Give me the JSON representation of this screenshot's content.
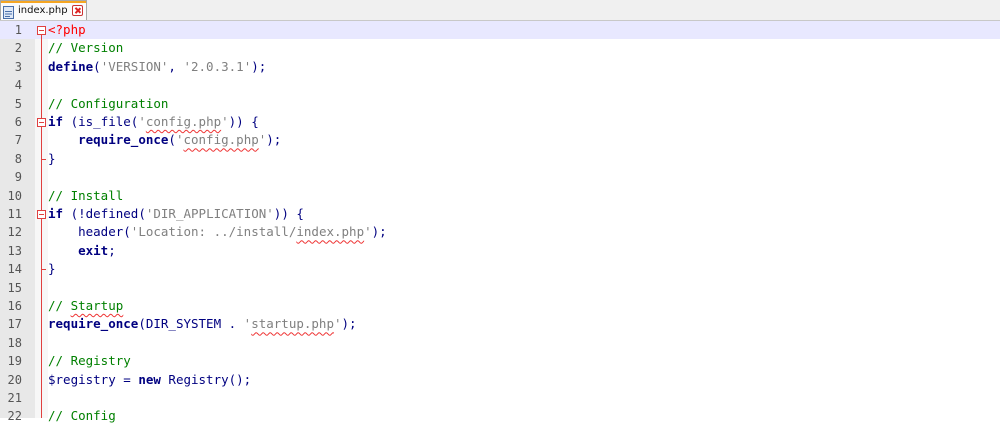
{
  "tab": {
    "filename": "index.php"
  },
  "editor": {
    "lines": [
      {
        "n": "1",
        "parts": [
          {
            "t": "<?php",
            "c": "php-tag"
          }
        ]
      },
      {
        "n": "2",
        "parts": [
          {
            "t": "// Version",
            "c": "comment"
          }
        ]
      },
      {
        "n": "3",
        "parts": [
          {
            "t": "define",
            "c": "kw"
          },
          {
            "t": "(",
            "c": "op"
          },
          {
            "t": "'VERSION'",
            "c": "str"
          },
          {
            "t": ", ",
            "c": "op"
          },
          {
            "t": "'2.0.3.1'",
            "c": "str"
          },
          {
            "t": ");",
            "c": "op"
          }
        ]
      },
      {
        "n": "4",
        "parts": []
      },
      {
        "n": "5",
        "parts": [
          {
            "t": "// Configuration",
            "c": "comment"
          }
        ]
      },
      {
        "n": "6",
        "parts": [
          {
            "t": "if",
            "c": "kw"
          },
          {
            "t": " (is_file(",
            "c": "op"
          },
          {
            "t": "'config.php'",
            "c": "str"
          },
          {
            "t": ")) {",
            "c": "op"
          }
        ]
      },
      {
        "n": "7",
        "parts": [
          {
            "t": "    ",
            "c": ""
          },
          {
            "t": "require_once",
            "c": "kw"
          },
          {
            "t": "(",
            "c": "op"
          },
          {
            "t": "'config.php'",
            "c": "str"
          },
          {
            "t": ");",
            "c": "op"
          }
        ]
      },
      {
        "n": "8",
        "parts": [
          {
            "t": "}",
            "c": "op"
          }
        ]
      },
      {
        "n": "9",
        "parts": []
      },
      {
        "n": "10",
        "parts": [
          {
            "t": "// Install",
            "c": "comment"
          }
        ]
      },
      {
        "n": "11",
        "parts": [
          {
            "t": "if",
            "c": "kw"
          },
          {
            "t": " (!defined(",
            "c": "op"
          },
          {
            "t": "'DIR_APPLICATION'",
            "c": "str"
          },
          {
            "t": ")) {",
            "c": "op"
          }
        ]
      },
      {
        "n": "12",
        "parts": [
          {
            "t": "    header(",
            "c": "op"
          },
          {
            "t": "'Location: ../install/index.php'",
            "c": "str"
          },
          {
            "t": ");",
            "c": "op"
          }
        ]
      },
      {
        "n": "13",
        "parts": [
          {
            "t": "    ",
            "c": ""
          },
          {
            "t": "exit",
            "c": "kw"
          },
          {
            "t": ";",
            "c": "op"
          }
        ]
      },
      {
        "n": "14",
        "parts": [
          {
            "t": "}",
            "c": "op"
          }
        ]
      },
      {
        "n": "15",
        "parts": []
      },
      {
        "n": "16",
        "parts": [
          {
            "t": "// Startup",
            "c": "comment"
          }
        ]
      },
      {
        "n": "17",
        "parts": [
          {
            "t": "require_once",
            "c": "kw"
          },
          {
            "t": "(DIR_SYSTEM . ",
            "c": "op"
          },
          {
            "t": "'startup.php'",
            "c": "str"
          },
          {
            "t": ");",
            "c": "op"
          }
        ]
      },
      {
        "n": "18",
        "parts": []
      },
      {
        "n": "19",
        "parts": [
          {
            "t": "// Registry",
            "c": "comment"
          }
        ]
      },
      {
        "n": "20",
        "parts": [
          {
            "t": "$registry",
            "c": "var"
          },
          {
            "t": " = ",
            "c": "op"
          },
          {
            "t": "new",
            "c": "kw"
          },
          {
            "t": " Registry();",
            "c": "op"
          }
        ]
      },
      {
        "n": "21",
        "parts": []
      },
      {
        "n": "22",
        "parts": [
          {
            "t": "// Config",
            "c": "comment"
          }
        ]
      }
    ]
  }
}
